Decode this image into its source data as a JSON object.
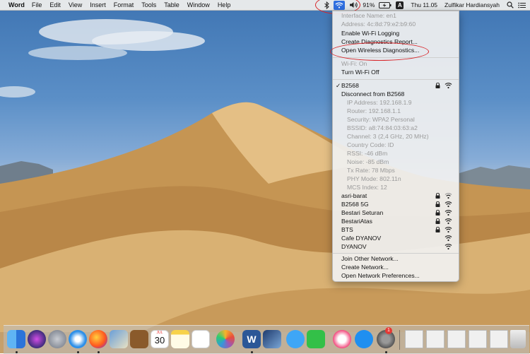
{
  "menubar": {
    "app": "Word",
    "menus": [
      "File",
      "Edit",
      "View",
      "Insert",
      "Format",
      "Tools",
      "Table",
      "Window",
      "Help"
    ],
    "battery": "91%",
    "input_source": "A",
    "clock": "Thu 11.05",
    "user": "Zulfikar Hardiansyah"
  },
  "wifi_menu": {
    "interface_name": "Interface Name: en1",
    "address": "Address: 4c:8d:79:e2:b9:60",
    "enable_logging": "Enable Wi-Fi Logging",
    "create_diagnostics": "Create Diagnostics Report...",
    "open_diagnostics": "Open Wireless Diagnostics...",
    "wifi_status": "Wi-Fi: On",
    "turn_off": "Turn Wi-Fi Off",
    "check_mark": "✓",
    "current_network": "B2568",
    "disconnect": "Disconnect from B2568",
    "details": [
      "IP Address: 192.168.1.9",
      "Router: 192.168.1.1",
      "Security: WPA2 Personal",
      "BSSID: a8:74:84:03:63:a2",
      "Channel: 3 (2,4 GHz, 20 MHz)",
      "Country Code: ID",
      "RSSI: -46 dBm",
      "Noise: -85 dBm",
      "Tx Rate: 78 Mbps",
      "PHY Mode: 802.11n",
      "MCS Index: 12"
    ],
    "networks": [
      {
        "name": "asri-barat",
        "locked": true
      },
      {
        "name": "B2568 5G",
        "locked": true
      },
      {
        "name": "Bestari Seturan",
        "locked": true
      },
      {
        "name": "BestariAtas",
        "locked": true
      },
      {
        "name": "BTS",
        "locked": true
      },
      {
        "name": "Cafe DYANOV",
        "locked": false
      },
      {
        "name": "DYANOV",
        "locked": false
      }
    ],
    "join_other": "Join Other Network...",
    "create_network": "Create Network...",
    "open_prefs": "Open Network Preferences..."
  },
  "dock": {
    "calendar_month": "JUL",
    "calendar_day": "30",
    "word_letter": "W",
    "appstore_badge": "1"
  },
  "colors": {
    "highlight_red": "#d8262a",
    "wifi_active_bg": "#2f6fe0"
  }
}
